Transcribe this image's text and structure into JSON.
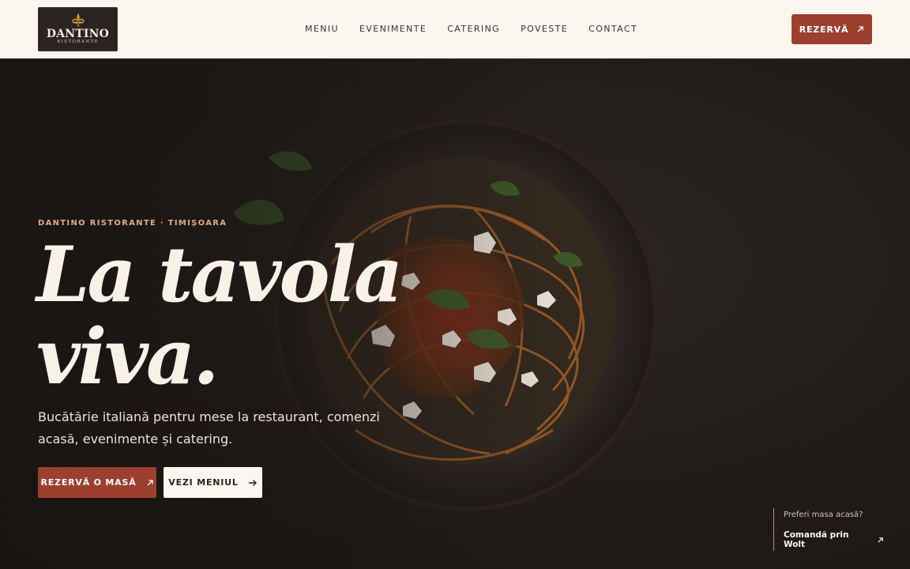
{
  "brand": {
    "name": "DANTINO",
    "subtitle": "RISTORANTE"
  },
  "nav": {
    "items": [
      {
        "label": "MENIU"
      },
      {
        "label": "EVENIMENTE"
      },
      {
        "label": "CATERING"
      },
      {
        "label": "POVESTE"
      },
      {
        "label": "CONTACT"
      }
    ]
  },
  "header": {
    "cta_label": "REZERVĂ",
    "cta_icon": "arrow-up-right-icon"
  },
  "hero": {
    "eyebrow": "DANTINO RISTORANTE · TIMIȘOARA",
    "headline_line1": "La tavola",
    "headline_line2": "viva.",
    "lead": "Bucătărie italiană pentru mese la restaurant, comenzi acasă, evenimente și catering.",
    "primary_label": "REZERVĂ O MASĂ",
    "secondary_label": "VEZI MENIUL",
    "secondary_icon": "arrow-right-icon"
  },
  "wolt": {
    "question": "Preferi masa acasă?",
    "link_label": "Comandă prin Wolt"
  },
  "colors": {
    "accent": "#9c3f2e",
    "cream": "#fbf6ee",
    "dark": "#1e1a18",
    "eyebrow": "#e0a98a"
  }
}
